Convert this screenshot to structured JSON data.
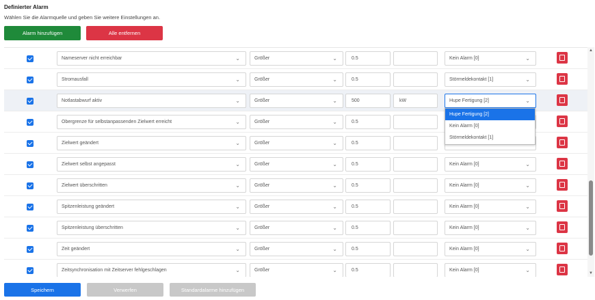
{
  "header": {
    "title": "Definierter Alarm",
    "subtitle": "Wählen Sie die Alarmquelle und geben Sie weitere Einstellungen an."
  },
  "actions": {
    "add": "Alarm hinzufügen",
    "remove": "Alle entfernen"
  },
  "rows": [
    {
      "checked": true,
      "name": "Nameserver nicht erreichbar",
      "operator": "Größer",
      "value": "0.5",
      "unit": "",
      "alarm": "Kein Alarm [0]"
    },
    {
      "checked": true,
      "name": "Stromausfall",
      "operator": "Größer",
      "value": "0.5",
      "unit": "",
      "alarm": "Störmeldekontakt [1]"
    },
    {
      "checked": true,
      "name": "Notlastabwurf aktiv",
      "operator": "Größer",
      "value": "500",
      "unit": "kW",
      "alarm": "Hupe Fertigung [2]"
    },
    {
      "checked": true,
      "name": "Obergrenze für selbstanpassenden Zielwert erreicht",
      "operator": "Größer",
      "value": "0.5",
      "unit": "",
      "alarm": ""
    },
    {
      "checked": true,
      "name": "Zielwert geändert",
      "operator": "Größer",
      "value": "0.5",
      "unit": "",
      "alarm": ""
    },
    {
      "checked": true,
      "name": "Zielwert selbst angepasst",
      "operator": "Größer",
      "value": "0.5",
      "unit": "",
      "alarm": "Kein Alarm [0]"
    },
    {
      "checked": true,
      "name": "Zielwert überschritten",
      "operator": "Größer",
      "value": "0.5",
      "unit": "",
      "alarm": "Kein Alarm [0]"
    },
    {
      "checked": true,
      "name": "Spitzenleistung geändert",
      "operator": "Größer",
      "value": "0.5",
      "unit": "",
      "alarm": "Kein Alarm [0]"
    },
    {
      "checked": true,
      "name": "Spitzenleistung überschritten",
      "operator": "Größer",
      "value": "0.5",
      "unit": "",
      "alarm": "Kein Alarm [0]"
    },
    {
      "checked": true,
      "name": "Zeit geändert",
      "operator": "Größer",
      "value": "0.5",
      "unit": "",
      "alarm": "Kein Alarm [0]"
    },
    {
      "checked": true,
      "name": "Zeitsynchronisation mit Zeitserver fehlgeschlagen",
      "operator": "Größer",
      "value": "0.5",
      "unit": "",
      "alarm": "Kein Alarm [0]"
    }
  ],
  "dropdown": {
    "options": [
      "Hupe Fertigung [2]",
      "Kein Alarm [0]",
      "Störmeldekontakt [1]"
    ],
    "selected": "Hupe Fertigung [2]"
  },
  "footer": {
    "save": "Speichern",
    "discard": "Verwerfen",
    "add_defaults": "Standardalarme hinzufügen"
  },
  "colors": {
    "primary": "#1a73e8",
    "success": "#1f8a3a",
    "danger": "#dc3545",
    "disabled": "#c8c8c8"
  },
  "icons": {
    "checkbox": "checkbox-checked-icon",
    "chevron": "chevron-down-icon",
    "delete": "trash-icon"
  }
}
